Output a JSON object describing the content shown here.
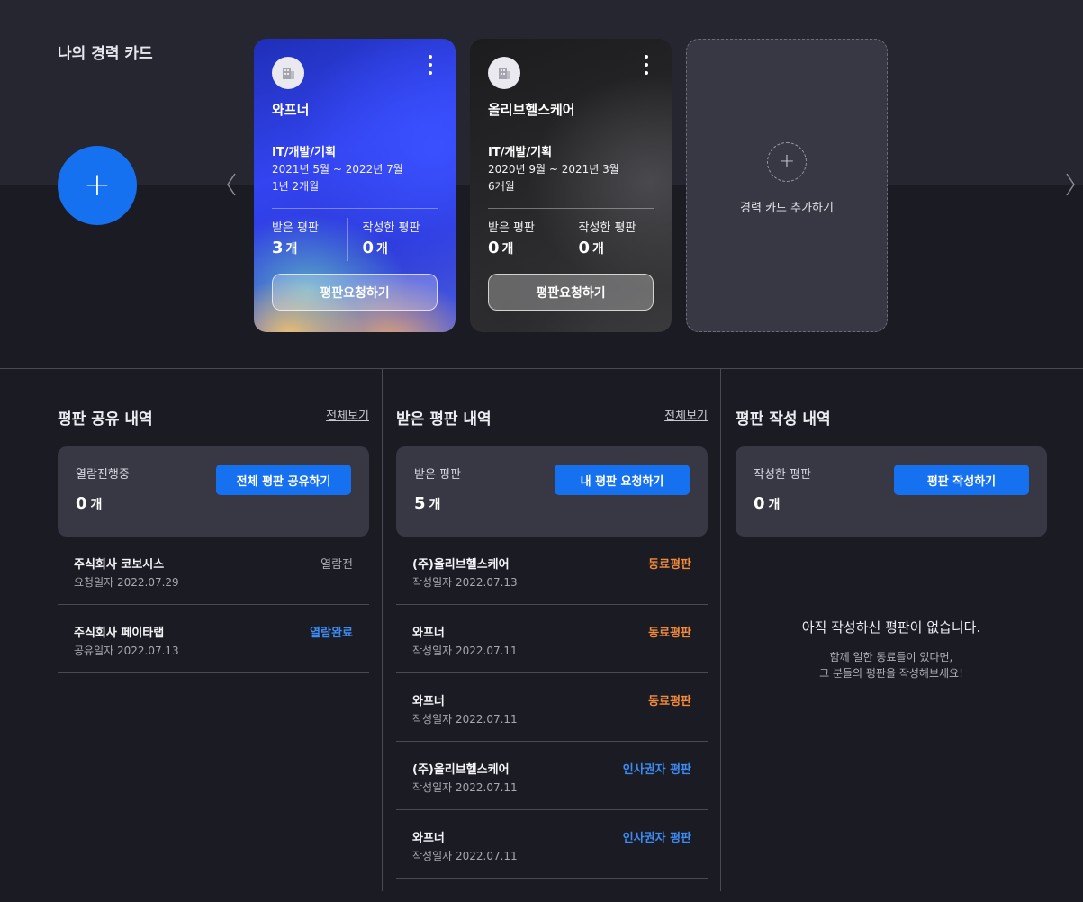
{
  "header": {
    "title": "나의 경력 카드",
    "add_icon": "plus-icon",
    "prev_icon": "chevron-left-icon",
    "next_icon": "chevron-right-icon"
  },
  "cards": [
    {
      "company": "와프너",
      "job": "IT/개발/기획",
      "period": "2021년 5월 ~ 2022년 7월",
      "duration": "1년 2개월",
      "received_label": "받은 평판",
      "received_value": "3",
      "written_label": "작성한 평판",
      "written_value": "0",
      "unit": "개",
      "button": "평판요청하기"
    },
    {
      "company": "올리브헬스케어",
      "job": "IT/개발/기획",
      "period": "2020년 9월 ~ 2021년 3월",
      "duration": "6개월",
      "received_label": "받은 평판",
      "received_value": "0",
      "written_label": "작성한 평판",
      "written_value": "0",
      "unit": "개",
      "button": "평판요청하기"
    }
  ],
  "add_card": {
    "label": "경력 카드 추가하기"
  },
  "share": {
    "title": "평판 공유 내역",
    "view_all": "전체보기",
    "summary_label": "열람진행중",
    "summary_value": "0",
    "unit": "개",
    "button": "전체 평판 공유하기",
    "items": [
      {
        "name": "주식회사 코보시스",
        "date": "요청일자 2022.07.29",
        "status": "열람전"
      },
      {
        "name": "주식회사 페이타랩",
        "date": "공유일자 2022.07.13",
        "status": "열람완료"
      }
    ]
  },
  "received": {
    "title": "받은 평판 내역",
    "view_all": "전체보기",
    "summary_label": "받은 평판",
    "summary_value": "5",
    "unit": "개",
    "button": "내 평판 요청하기",
    "items": [
      {
        "name": "(주)올리브헬스케어",
        "date": "작성일자 2022.07.13",
        "status": "동료평판"
      },
      {
        "name": "와프너",
        "date": "작성일자 2022.07.11",
        "status": "동료평판"
      },
      {
        "name": "와프너",
        "date": "작성일자 2022.07.11",
        "status": "동료평판"
      },
      {
        "name": "(주)올리브헬스케어",
        "date": "작성일자 2022.07.11",
        "status": "인사권자 평판"
      },
      {
        "name": "와프너",
        "date": "작성일자 2022.07.11",
        "status": "인사권자 평판"
      }
    ]
  },
  "written": {
    "title": "평판 작성 내역",
    "summary_label": "작성한 평판",
    "summary_value": "0",
    "unit": "개",
    "button": "평판 작성하기",
    "empty_title": "아직 작성하신 평판이 없습니다.",
    "empty_line1": "함께 일한 동료들이 있다면,",
    "empty_line2": "그 분들의 평판을 작성해보세요!"
  },
  "colors": {
    "accent": "#1671f0",
    "status_blue": "#3b8cf5",
    "status_orange": "#f28a3c",
    "status_gray": "#a8a8b2"
  }
}
